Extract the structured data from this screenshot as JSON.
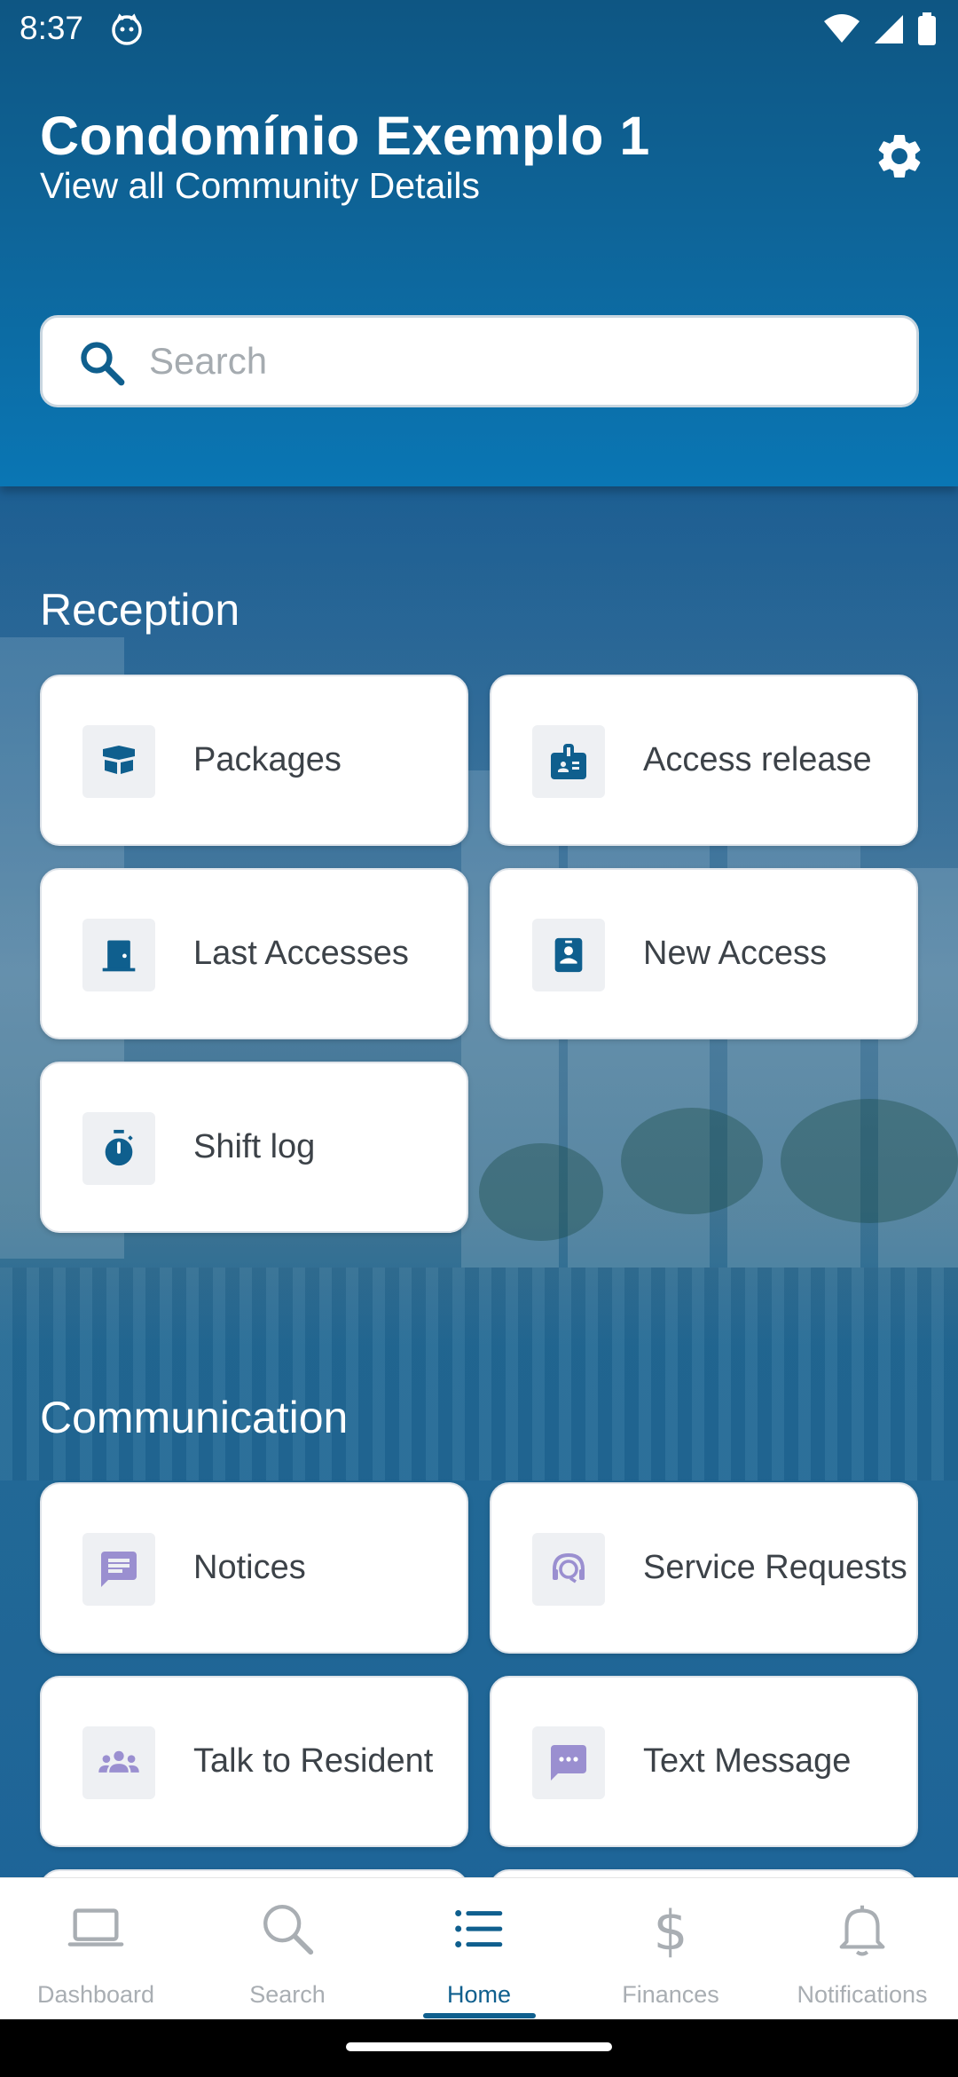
{
  "status_bar": {
    "time": "8:37"
  },
  "header": {
    "title": "Condomínio Exemplo 1",
    "subtitle": "View all Community Details",
    "settings_icon": "gear-icon"
  },
  "search": {
    "placeholder": "Search",
    "value": ""
  },
  "sections": {
    "reception": {
      "title": "Reception",
      "items": [
        {
          "label": "Packages",
          "icon": "package-box-icon"
        },
        {
          "label": "Access release",
          "icon": "id-badge-icon"
        },
        {
          "label": "Last Accesses",
          "icon": "door-icon"
        },
        {
          "label": "New Access",
          "icon": "contact-card-icon"
        },
        {
          "label": "Shift log",
          "icon": "stopwatch-icon"
        }
      ]
    },
    "communication": {
      "title": "Communication",
      "items": [
        {
          "label": "Notices",
          "icon": "notice-message-icon"
        },
        {
          "label": "Service Requests",
          "icon": "support-agent-icon"
        },
        {
          "label": "Talk to Resident",
          "icon": "group-icon"
        },
        {
          "label": "Text Message",
          "icon": "chat-dots-icon"
        }
      ]
    }
  },
  "colors": {
    "primary": "#0f5f8e",
    "reception_icon": "#0f5f8e",
    "communication_icon": "#9a8fd0",
    "inactive_nav": "#a9aeb3"
  },
  "bottom_nav": {
    "items": [
      {
        "label": "Dashboard",
        "icon": "laptop-icon"
      },
      {
        "label": "Search",
        "icon": "magnifier-icon"
      },
      {
        "label": "Home",
        "icon": "list-icon"
      },
      {
        "label": "Finances",
        "icon": "dollar-icon"
      },
      {
        "label": "Notifications",
        "icon": "bell-icon"
      }
    ],
    "active": "Home"
  }
}
